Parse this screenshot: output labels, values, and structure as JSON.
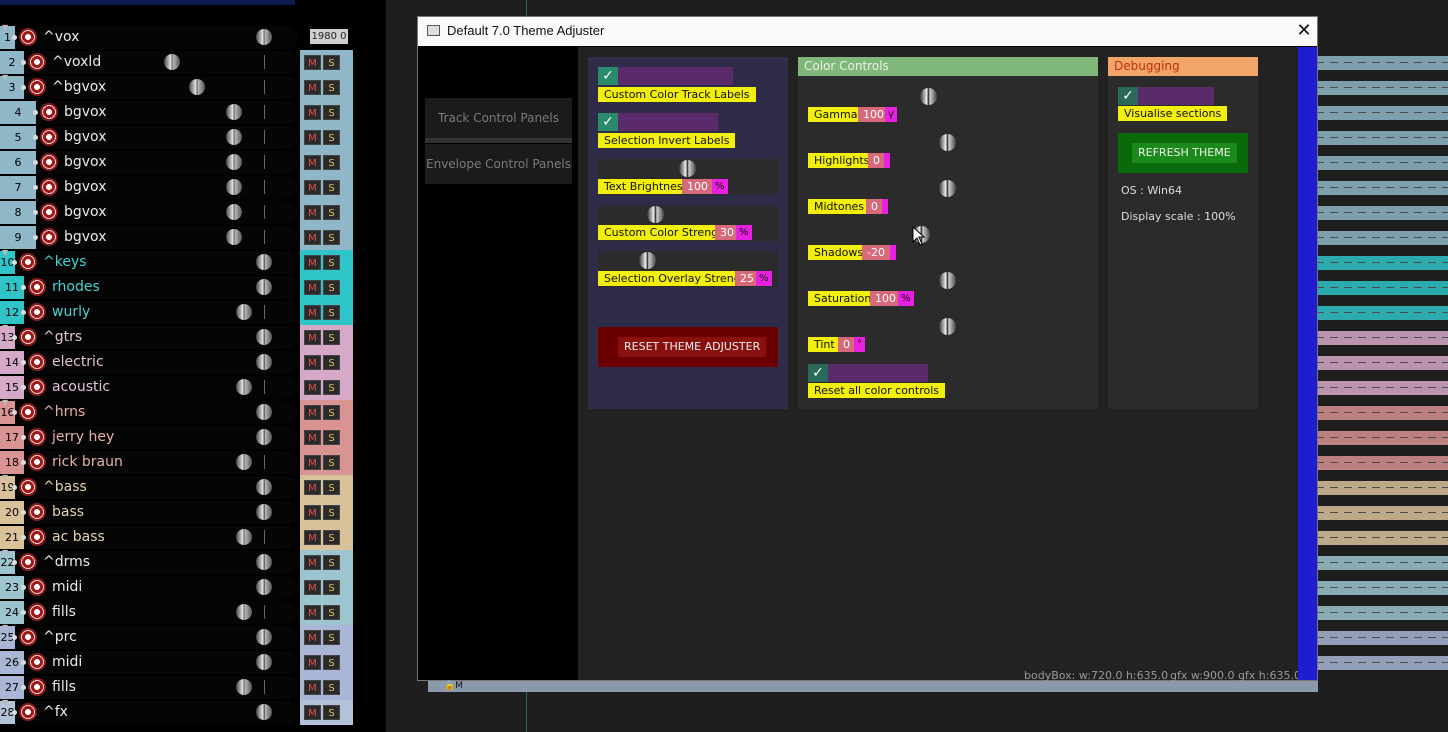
{
  "dialog": {
    "title": "Default 7.0 Theme Adjuster",
    "close_label": "✕",
    "tabs": [
      "Track Control Panels",
      "Envelope Control Panels"
    ]
  },
  "general": {
    "custom_color_labels": "Custom Color Track Labels",
    "selection_invert": "Selection Invert Labels",
    "text_brightness": {
      "label": "Text Brightness",
      "value": "100",
      "unit": "%"
    },
    "custom_color_strength": {
      "label": "Custom Color Strength",
      "value": "30",
      "unit": "%"
    },
    "selection_overlay": {
      "label": "Selection Overlay Strength",
      "value": "25",
      "unit": "%"
    },
    "reset_button": "RESET THEME ADJUSTER"
  },
  "color_controls": {
    "header": "Color Controls",
    "gamma": {
      "label": "Gamma",
      "value": "100",
      "unit": "γ"
    },
    "highlights": {
      "label": "Highlights",
      "value": "0"
    },
    "midtones": {
      "label": "Midtones",
      "value": "0"
    },
    "shadows": {
      "label": "Shadows",
      "value": "-20"
    },
    "saturation": {
      "label": "Saturation",
      "value": "100",
      "unit": "%"
    },
    "tint": {
      "label": "Tint",
      "value": "0",
      "unit": "°"
    },
    "reset_all": "Reset all color controls"
  },
  "debugging": {
    "header": "Debugging",
    "visualise": "Visualise sections",
    "refresh_button": "REFRESH THEME",
    "os": "OS : Win64",
    "scale": "Display scale : 100%"
  },
  "status": {
    "body_box": "bodyBox: w:720.0  h:635.0",
    "gfx": "gfx w:900.0  gfx h:635.0"
  },
  "tracks": [
    {
      "num": "1",
      "name": "^vox",
      "color": "#8fb7c7"
    },
    {
      "num": "2",
      "name": "^voxld",
      "color": "#8fb7c7"
    },
    {
      "num": "3",
      "name": "^bgvox",
      "color": "#8fb7c7"
    },
    {
      "num": "4",
      "name": "bgvox",
      "color": "#8fb7c7"
    },
    {
      "num": "5",
      "name": "bgvox",
      "color": "#8fb7c7"
    },
    {
      "num": "6",
      "name": "bgvox",
      "color": "#8fb7c7"
    },
    {
      "num": "7",
      "name": "bgvox",
      "color": "#8fb7c7"
    },
    {
      "num": "8",
      "name": "bgvox",
      "color": "#8fb7c7"
    },
    {
      "num": "9",
      "name": "bgvox",
      "color": "#8fb7c7"
    },
    {
      "num": "10",
      "name": "^keys",
      "color": "#2fc4c8"
    },
    {
      "num": "11",
      "name": "rhodes",
      "color": "#2fc4c8"
    },
    {
      "num": "12",
      "name": "wurly",
      "color": "#2fc4c8"
    },
    {
      "num": "13",
      "name": "^gtrs",
      "color": "#d7a9c9"
    },
    {
      "num": "14",
      "name": "electric",
      "color": "#d7a9c9"
    },
    {
      "num": "15",
      "name": "acoustic",
      "color": "#d7a9c9"
    },
    {
      "num": "16",
      "name": "^hrns",
      "color": "#d99393"
    },
    {
      "num": "17",
      "name": "jerry hey",
      "color": "#d99393"
    },
    {
      "num": "18",
      "name": "rick braun",
      "color": "#d99393"
    },
    {
      "num": "19",
      "name": "^bass",
      "color": "#d9c29a"
    },
    {
      "num": "20",
      "name": "bass",
      "color": "#d9c29a"
    },
    {
      "num": "21",
      "name": "ac bass",
      "color": "#d9c29a"
    },
    {
      "num": "22",
      "name": "^drms",
      "color": "#9cc5cf"
    },
    {
      "num": "23",
      "name": "midi",
      "color": "#9cc5cf"
    },
    {
      "num": "24",
      "name": "fills",
      "color": "#9cc5cf"
    },
    {
      "num": "25",
      "name": "^prc",
      "color": "#a9b6d6"
    },
    {
      "num": "26",
      "name": "midi",
      "color": "#a9b6d6"
    },
    {
      "num": "27",
      "name": "fills",
      "color": "#a9b6d6"
    },
    {
      "num": "28",
      "name": "^fx",
      "color": "#b3c2d9"
    }
  ],
  "counter": "1980 0"
}
